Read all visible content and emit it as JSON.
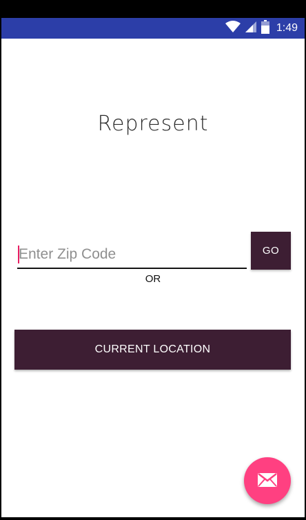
{
  "status_bar": {
    "time": "1:49",
    "icons": [
      "wifi-icon",
      "cell-signal-icon",
      "battery-icon"
    ],
    "color": "#2c3ea8"
  },
  "app": {
    "title": "Represent"
  },
  "zip_search": {
    "placeholder": "Enter Zip Code",
    "value": "",
    "go_label": "GO"
  },
  "or_label": "OR",
  "current_location": {
    "label": "CURRENT LOCATION"
  },
  "fab": {
    "icon": "envelope-icon"
  },
  "colors": {
    "primary_dark": "#3d1e33",
    "accent": "#ff4081",
    "status_bar": "#2c3ea8"
  }
}
